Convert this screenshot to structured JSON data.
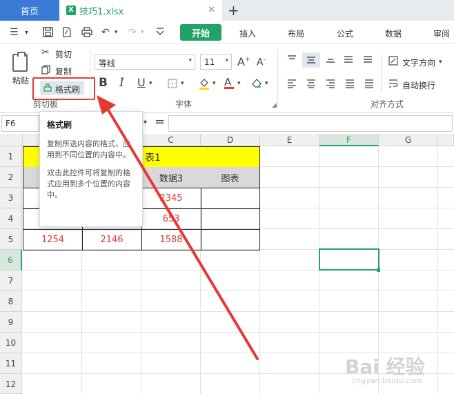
{
  "tabs": {
    "home_label": "首页",
    "file_name": "技巧1.xlsx",
    "file_icon": "X",
    "close_icon": "✕",
    "add_icon": "+"
  },
  "menu": {
    "start_label": "开始",
    "items": [
      "插入",
      "布局",
      "公式",
      "数据",
      "审阅"
    ]
  },
  "ribbon": {
    "paste_label": "粘贴",
    "cut_label": "剪切",
    "copy_label": "复制",
    "format_painter_label": "格式刷",
    "clipboard_group": "剪切板",
    "font_name": "等线",
    "font_size": "11",
    "font_group": "字体",
    "bold": "B",
    "italic": "I",
    "underline": "U",
    "text_direction_label": "文字方向",
    "wrap_text_label": "自动换行",
    "align_group": "对齐方式"
  },
  "formula_bar": {
    "cell_ref": "F6",
    "equals": "="
  },
  "grid": {
    "columns": [
      "C",
      "D",
      "E",
      "F",
      "G"
    ],
    "rows": [
      "1",
      "2",
      "3",
      "4",
      "5",
      "6",
      "7",
      "8",
      "9",
      "10",
      "11",
      "12"
    ],
    "merged_title_visible": "表1",
    "header_c2": "数据3",
    "header_d2": "图表",
    "c3": "2345",
    "c4": "653",
    "a5": "1254",
    "b5": "2146",
    "c5": "1588"
  },
  "tooltip": {
    "title": "格式刷",
    "para1": "复制所选内容的格式，应用到不同位置的内容中。",
    "para2": "双击此控件可将复制的格式应用到多个位置的内容中。"
  },
  "watermark": {
    "text": "Bai 经验",
    "url": "jingyan.baidu.com"
  },
  "colors": {
    "accent_green": "#21a366",
    "home_tab_blue": "#3a7bd5",
    "highlight_red": "#e53935",
    "title_fill_yellow": "#ffff00",
    "header_fill_gray": "#d9d9d9",
    "value_red": "#e23a3a"
  }
}
